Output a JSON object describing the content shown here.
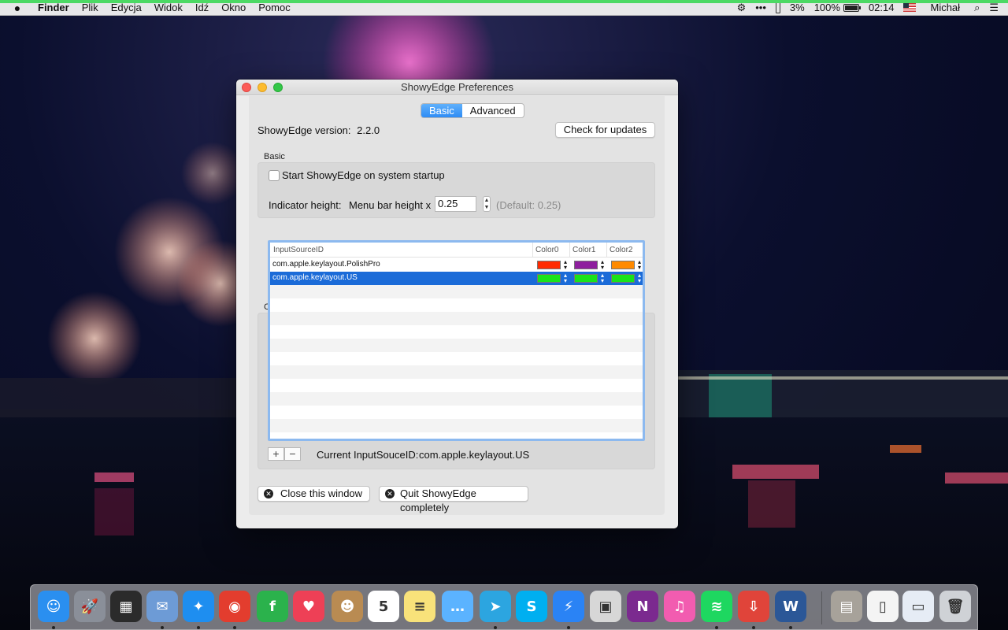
{
  "menubar": {
    "app_name": "Finder",
    "items": [
      "Plik",
      "Edycja",
      "Widok",
      "Idź",
      "Okno",
      "Pomoc"
    ],
    "status": {
      "cpu_percent": "3%",
      "battery_percent": "100%",
      "time": "02:14",
      "user": "Michał"
    }
  },
  "window": {
    "title": "ShowyEdge Preferences",
    "tabs": [
      {
        "label": "Basic",
        "active": true
      },
      {
        "label": "Advanced",
        "active": false
      }
    ],
    "version_label": "ShowyEdge version:",
    "version_value": "2.2.0",
    "check_updates_label": "Check for updates",
    "basic_group": {
      "title": "Basic",
      "startup_label": "Start ShowyEdge on system startup",
      "startup_checked": false,
      "indicator_label": "Indicator height:",
      "menubar_height_label": "Menu bar height x",
      "height_value": "0.25",
      "default_hint": "(Default: 0.25)"
    },
    "color_group": {
      "title": "Color",
      "columns": [
        "InputSourceID",
        "Color0",
        "Color1",
        "Color2"
      ],
      "rows": [
        {
          "id": "com.apple.keylayout.PolishPro",
          "colors": [
            "#ff2a00",
            "#8e1f9e",
            "#ff8a00"
          ],
          "selected": false
        },
        {
          "id": "com.apple.keylayout.US",
          "colors": [
            "#19e319",
            "#19e319",
            "#19e319"
          ],
          "selected": true
        }
      ],
      "add_label": "+",
      "remove_label": "−",
      "current_label": "Current InputSouceID:",
      "current_value": "com.apple.keylayout.US"
    },
    "close_window_label": "Close this window",
    "quit_label": "Quit ShowyEdge completely"
  },
  "dock": {
    "apps": [
      {
        "name": "finder-icon",
        "glyph": "☺",
        "color": "#2a8ff0",
        "running": true
      },
      {
        "name": "launchpad-icon",
        "glyph": "🚀",
        "color": "#8a8f99",
        "running": false
      },
      {
        "name": "activity-monitor-icon",
        "glyph": "▦",
        "color": "#2b2b2b",
        "running": false
      },
      {
        "name": "mail-stamp-icon",
        "glyph": "✉",
        "color": "#6d9bd6",
        "running": true
      },
      {
        "name": "safari-icon",
        "glyph": "✦",
        "color": "#1e8ef0",
        "running": true
      },
      {
        "name": "chrome-icon",
        "glyph": "◉",
        "color": "#e33d2e",
        "running": true
      },
      {
        "name": "feedly-icon",
        "glyph": "f",
        "color": "#2bb24c",
        "running": false
      },
      {
        "name": "pocket-icon",
        "glyph": "♥",
        "color": "#ee4056",
        "running": false
      },
      {
        "name": "contacts-icon",
        "glyph": "☻",
        "color": "#b98b52",
        "running": false
      },
      {
        "name": "calendar-icon",
        "glyph": "5",
        "color": "#ffffff",
        "running": false
      },
      {
        "name": "notes-icon",
        "glyph": "≡",
        "color": "#f8e27a",
        "running": false
      },
      {
        "name": "messages-icon",
        "glyph": "…",
        "color": "#5bb3ff",
        "running": false
      },
      {
        "name": "telegram-icon",
        "glyph": "➤",
        "color": "#2ca5e0",
        "running": true
      },
      {
        "name": "skype-icon",
        "glyph": "S",
        "color": "#00aff0",
        "running": false
      },
      {
        "name": "messenger-icon",
        "glyph": "⚡",
        "color": "#2a83f5",
        "running": true
      },
      {
        "name": "preview-icon",
        "glyph": "▣",
        "color": "#d7d7d7",
        "running": false
      },
      {
        "name": "onenote-icon",
        "glyph": "N",
        "color": "#7b2a8f",
        "running": false
      },
      {
        "name": "itunes-icon",
        "glyph": "♫",
        "color": "#f25cb0",
        "running": false
      },
      {
        "name": "spotify-icon",
        "glyph": "≋",
        "color": "#1ed760",
        "running": true
      },
      {
        "name": "showyedge-icon",
        "glyph": "⇩",
        "color": "#e0443a",
        "running": true
      },
      {
        "name": "word-icon",
        "glyph": "W",
        "color": "#2b5797",
        "running": true
      },
      {
        "name": "photos-folder-icon",
        "glyph": "▤",
        "color": "#a7a29a",
        "running": false
      },
      {
        "name": "jpeg-file-icon",
        "glyph": "▯",
        "color": "#f4f4f4",
        "running": false
      },
      {
        "name": "documents-icon",
        "glyph": "▭",
        "color": "#e6ecf5",
        "running": false
      },
      {
        "name": "trash-icon",
        "glyph": "🗑",
        "color": "#cfd2d6",
        "running": false
      }
    ]
  }
}
